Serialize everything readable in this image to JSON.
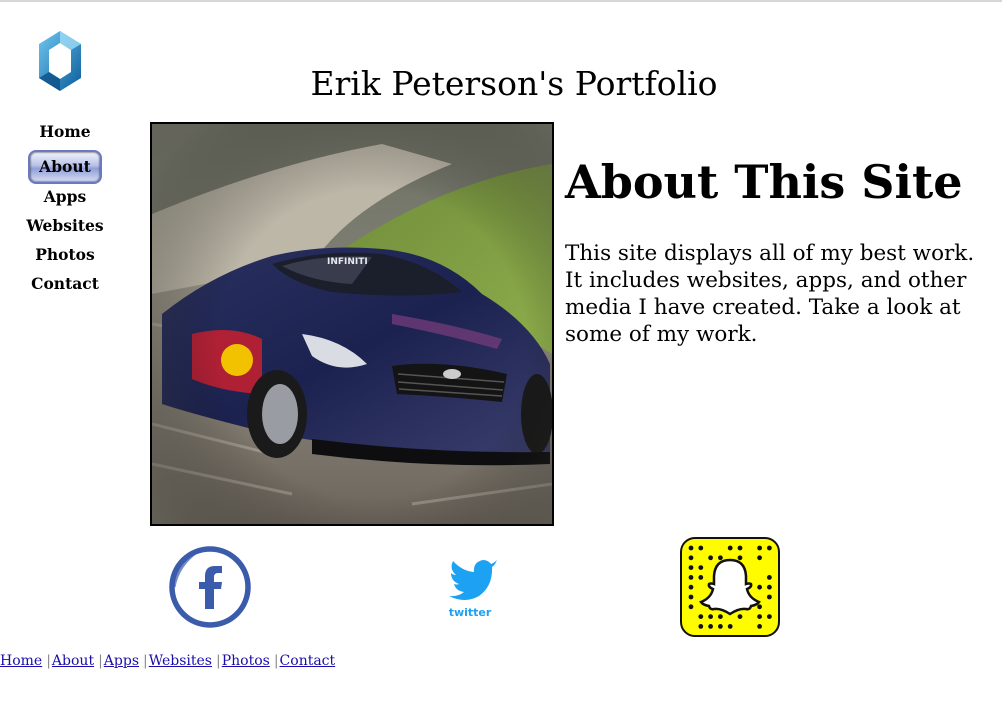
{
  "header": {
    "title": "Erik Peterson's Portfolio",
    "logo_icon": "hexagon-logo-icon"
  },
  "nav": {
    "items": [
      {
        "label": "Home",
        "active": false
      },
      {
        "label": "About",
        "active": true
      },
      {
        "label": "Apps",
        "active": false
      },
      {
        "label": "Websites",
        "active": false
      },
      {
        "label": "Photos",
        "active": false
      },
      {
        "label": "Contact",
        "active": false
      }
    ]
  },
  "main": {
    "heading": "About This Site",
    "paragraph": "This site displays all of my best work. It includes websites, apps, and other media I have created. Take a look at some of my work.",
    "image_icon": "race-car-photo"
  },
  "social": {
    "facebook_icon": "facebook-icon",
    "twitter_icon": "twitter-icon",
    "twitter_wordmark": "twitter",
    "snapchat_icon": "snapchat-snapcode-icon"
  },
  "footer": {
    "links": [
      "Home",
      "About",
      "Apps",
      "Websites",
      "Photos",
      "Contact"
    ]
  },
  "colors": {
    "accent": "#6b79c4",
    "facebook": "#3b5bab",
    "twitter": "#1da1f2",
    "snapchat": "#fffc00",
    "link": "#1a0dab"
  }
}
